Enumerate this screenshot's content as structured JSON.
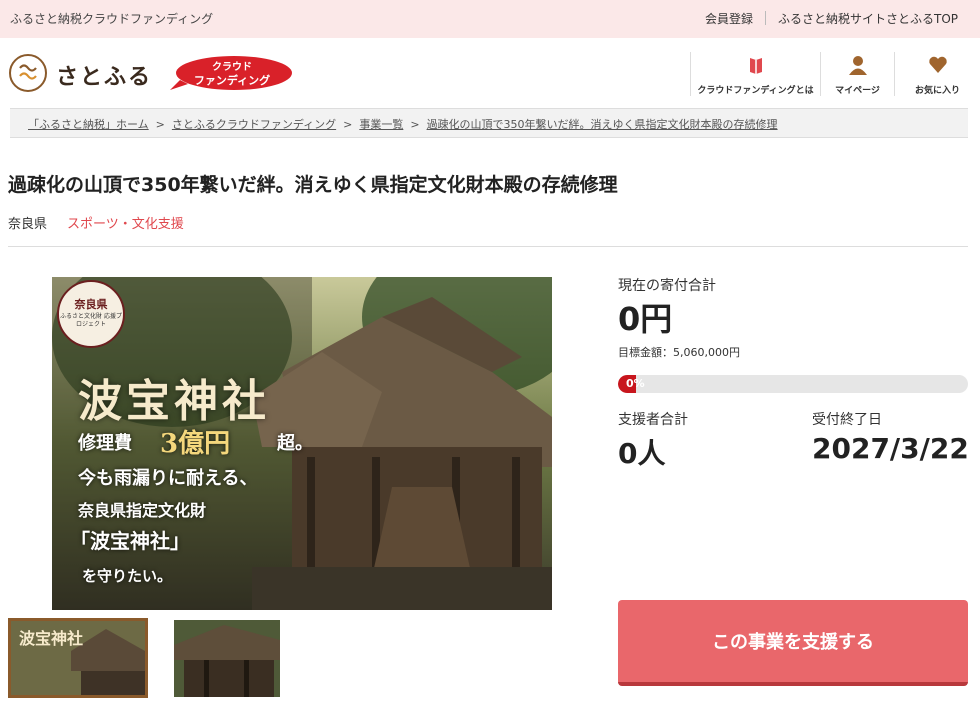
{
  "topbar": {
    "tagline": "ふるさと納税クラウドファンディング",
    "links": [
      "会員登録",
      "ふるさと納税サイトさとふるTOP"
    ]
  },
  "header": {
    "logo_text": "さとふる",
    "badge_line1": "クラウド",
    "badge_line2": "ファンディング",
    "nav": [
      {
        "label": "クラウドファンディングとは",
        "icon": "book-icon"
      },
      {
        "label": "マイページ",
        "icon": "user-icon"
      },
      {
        "label": "お気に入り",
        "icon": "heart-icon"
      }
    ],
    "accent": "#e0484e"
  },
  "breadcrumb": {
    "items": [
      "「ふるさと納税」ホーム",
      "さとふるクラウドファンディング",
      "事業一覧",
      "過疎化の山頂で350年繋いだ絆。消えゆく県指定文化財本殿の存続修理"
    ],
    "separator": ">"
  },
  "project": {
    "title": "過疎化の山頂で350年繋いだ絆。消えゆく県指定文化財本殿の存続修理",
    "prefecture": "奈良県",
    "category": "スポーツ・文化支援"
  },
  "hero": {
    "seal_top": "奈良県",
    "seal_sub": "ふるさと文化財 応援プロジェクト",
    "name": "波宝神社",
    "line1a": "修理費",
    "line1b": "3億円",
    "line1c": "超。",
    "line2": "今も雨漏りに耐える、",
    "line3": "奈良県指定文化財",
    "line4": "「波宝神社」",
    "line5": "を守りたい。"
  },
  "thumbs": {
    "thumb1_text": "波宝神社"
  },
  "stats": {
    "total_label": "現在の寄付合計",
    "total_value": "0円",
    "goal_text": "目標金額：5,060,000円",
    "progress_label": "0%",
    "progress_fraction": 0,
    "supporters_label": "支援者合計",
    "supporters_value": "0人",
    "end_label": "受付終了日",
    "end_value": "2027/3/22",
    "progress_color": "#c8161d"
  },
  "cta": {
    "label": "この事業を支援する",
    "color": "#e9676b"
  }
}
